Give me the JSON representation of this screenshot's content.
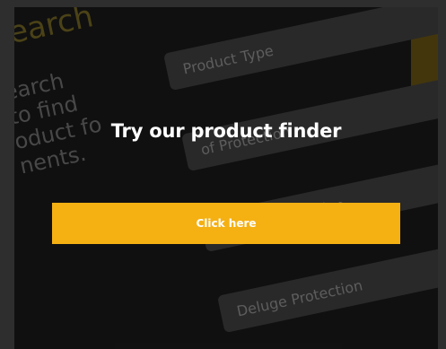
{
  "background": {
    "heading": "earch",
    "body_lines": [
      "earch",
      "to find",
      "oduct fo",
      "nents."
    ],
    "cards": [
      "Product Type",
      "of Protection",
      "ling Configuration",
      "Deluge Protection"
    ]
  },
  "promo": {
    "headline": "Try our product finder",
    "button_label": "Click here"
  },
  "colors": {
    "accent": "#f5b012",
    "panel": "#151515"
  }
}
